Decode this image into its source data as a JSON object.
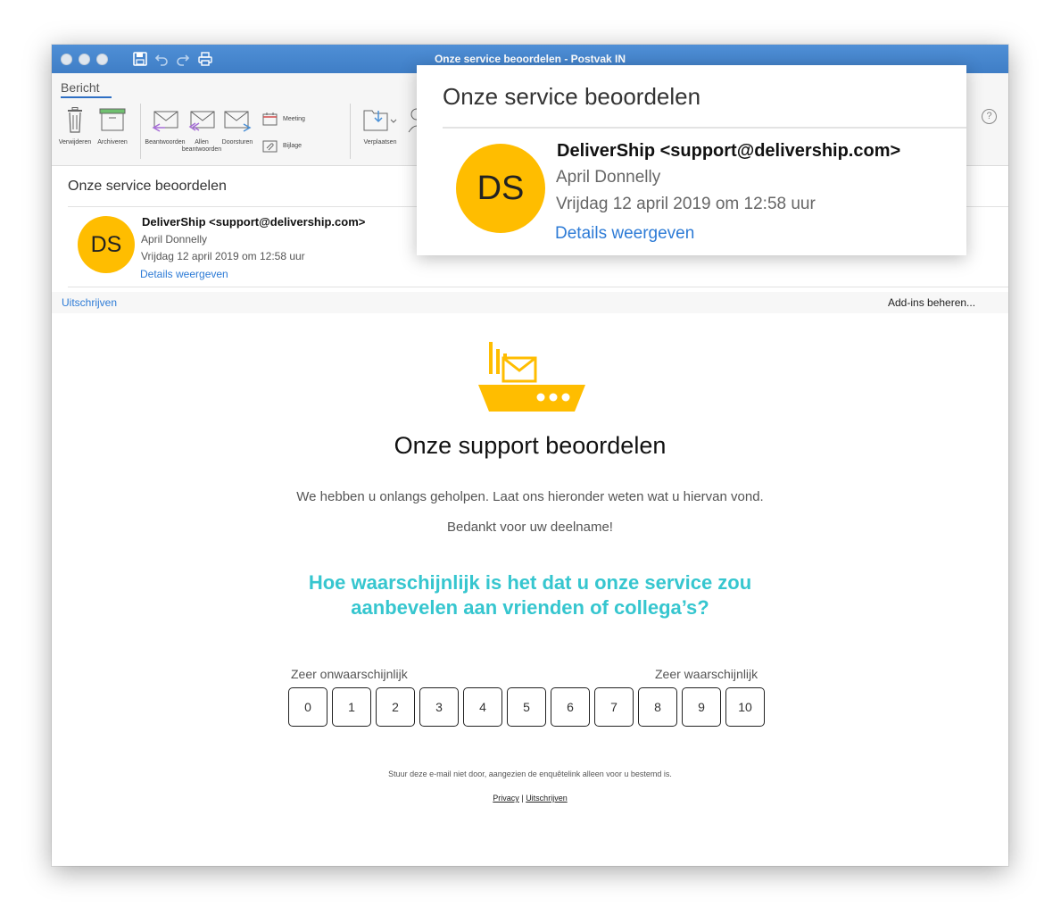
{
  "window": {
    "title": "Onze service beoordelen - Postvak IN"
  },
  "ribbon": {
    "tab": "Bericht",
    "buttons": {
      "delete": "Verwijderen",
      "archive": "Archiveren",
      "reply": "Beantwoorden",
      "reply_all_line1": "Allen",
      "reply_all_line2": "beantwoorden",
      "forward": "Doorsturen",
      "meeting": "Meeting",
      "attachment": "Bijlage",
      "move": "Verplaatsen"
    },
    "help": "?"
  },
  "message": {
    "subject": "Onze service beoordelen",
    "avatar_initials": "DS",
    "sender": "DeliverShip <support@delivership.com>",
    "to": "April Donnelly",
    "date": "Vrijdag 12 april 2019 om 12:58 uur",
    "details_link": "Details weergeven"
  },
  "infobar": {
    "unsubscribe": "Uitschrijven",
    "manage_addins": "Add-ins beheren..."
  },
  "body": {
    "heading": "Onze support beoordelen",
    "paragraph1": "We hebben u onlangs geholpen. Laat ons hieronder weten wat u hiervan vond.",
    "paragraph2": "Bedankt voor uw deelname!",
    "question": "Hoe waarschijnlijk is het dat u onze service zou aanbevelen aan vrienden of collega’s?",
    "label_unlikely": "Zeer onwaarschijnlijk",
    "label_likely": "Zeer waarschijnlijk",
    "scores": [
      "0",
      "1",
      "2",
      "3",
      "4",
      "5",
      "6",
      "7",
      "8",
      "9",
      "10"
    ],
    "footer_note": "Stuur deze e-mail niet door, aangezien de enquêtelink alleen voor u bestemd is.",
    "footer_privacy": "Privacy",
    "footer_separator": "|",
    "footer_unsubscribe": "Uitschrijven"
  },
  "colors": {
    "accent_yellow": "#ffbd00",
    "question_teal": "#36c6cf",
    "link_blue": "#2d7bd6",
    "titlebar_blue": "#4683cc"
  }
}
